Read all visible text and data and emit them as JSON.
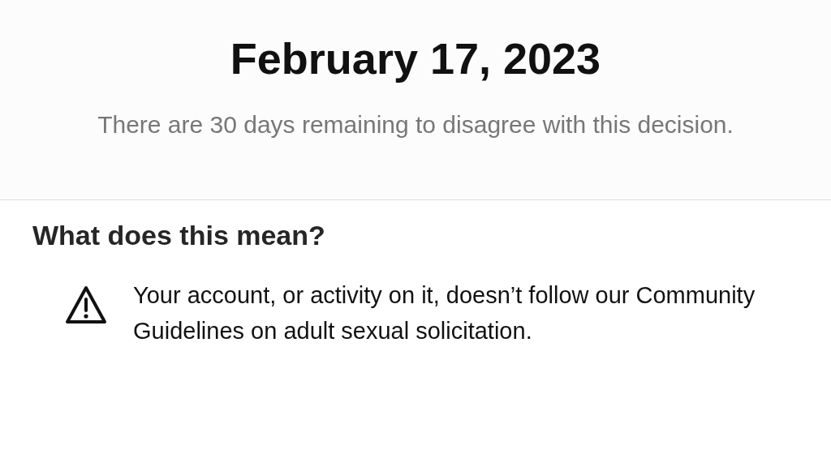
{
  "header": {
    "date_heading": "February 17, 2023",
    "subtitle": "There are 30 days remaining to disagree with this decision."
  },
  "explanation": {
    "title": "What does this mean?",
    "items": [
      {
        "kind": "warning",
        "text": "Your account, or activity on it, doesn’t follow our Community Guidelines on adult sexual solicitation."
      }
    ]
  }
}
